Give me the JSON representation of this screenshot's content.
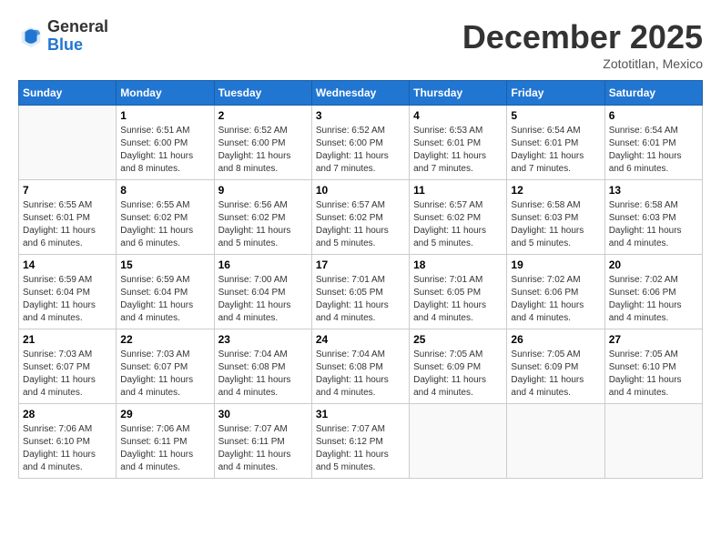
{
  "header": {
    "logo_general": "General",
    "logo_blue": "Blue",
    "month_title": "December 2025",
    "location": "Zototitlan, Mexico"
  },
  "days_of_week": [
    "Sunday",
    "Monday",
    "Tuesday",
    "Wednesday",
    "Thursday",
    "Friday",
    "Saturday"
  ],
  "weeks": [
    [
      {
        "day": "",
        "sunrise": "",
        "sunset": "",
        "daylight": ""
      },
      {
        "day": "1",
        "sunrise": "Sunrise: 6:51 AM",
        "sunset": "Sunset: 6:00 PM",
        "daylight": "Daylight: 11 hours and 8 minutes."
      },
      {
        "day": "2",
        "sunrise": "Sunrise: 6:52 AM",
        "sunset": "Sunset: 6:00 PM",
        "daylight": "Daylight: 11 hours and 8 minutes."
      },
      {
        "day": "3",
        "sunrise": "Sunrise: 6:52 AM",
        "sunset": "Sunset: 6:00 PM",
        "daylight": "Daylight: 11 hours and 7 minutes."
      },
      {
        "day": "4",
        "sunrise": "Sunrise: 6:53 AM",
        "sunset": "Sunset: 6:01 PM",
        "daylight": "Daylight: 11 hours and 7 minutes."
      },
      {
        "day": "5",
        "sunrise": "Sunrise: 6:54 AM",
        "sunset": "Sunset: 6:01 PM",
        "daylight": "Daylight: 11 hours and 7 minutes."
      },
      {
        "day": "6",
        "sunrise": "Sunrise: 6:54 AM",
        "sunset": "Sunset: 6:01 PM",
        "daylight": "Daylight: 11 hours and 6 minutes."
      }
    ],
    [
      {
        "day": "7",
        "sunrise": "Sunrise: 6:55 AM",
        "sunset": "Sunset: 6:01 PM",
        "daylight": "Daylight: 11 hours and 6 minutes."
      },
      {
        "day": "8",
        "sunrise": "Sunrise: 6:55 AM",
        "sunset": "Sunset: 6:02 PM",
        "daylight": "Daylight: 11 hours and 6 minutes."
      },
      {
        "day": "9",
        "sunrise": "Sunrise: 6:56 AM",
        "sunset": "Sunset: 6:02 PM",
        "daylight": "Daylight: 11 hours and 5 minutes."
      },
      {
        "day": "10",
        "sunrise": "Sunrise: 6:57 AM",
        "sunset": "Sunset: 6:02 PM",
        "daylight": "Daylight: 11 hours and 5 minutes."
      },
      {
        "day": "11",
        "sunrise": "Sunrise: 6:57 AM",
        "sunset": "Sunset: 6:02 PM",
        "daylight": "Daylight: 11 hours and 5 minutes."
      },
      {
        "day": "12",
        "sunrise": "Sunrise: 6:58 AM",
        "sunset": "Sunset: 6:03 PM",
        "daylight": "Daylight: 11 hours and 5 minutes."
      },
      {
        "day": "13",
        "sunrise": "Sunrise: 6:58 AM",
        "sunset": "Sunset: 6:03 PM",
        "daylight": "Daylight: 11 hours and 4 minutes."
      }
    ],
    [
      {
        "day": "14",
        "sunrise": "Sunrise: 6:59 AM",
        "sunset": "Sunset: 6:04 PM",
        "daylight": "Daylight: 11 hours and 4 minutes."
      },
      {
        "day": "15",
        "sunrise": "Sunrise: 6:59 AM",
        "sunset": "Sunset: 6:04 PM",
        "daylight": "Daylight: 11 hours and 4 minutes."
      },
      {
        "day": "16",
        "sunrise": "Sunrise: 7:00 AM",
        "sunset": "Sunset: 6:04 PM",
        "daylight": "Daylight: 11 hours and 4 minutes."
      },
      {
        "day": "17",
        "sunrise": "Sunrise: 7:01 AM",
        "sunset": "Sunset: 6:05 PM",
        "daylight": "Daylight: 11 hours and 4 minutes."
      },
      {
        "day": "18",
        "sunrise": "Sunrise: 7:01 AM",
        "sunset": "Sunset: 6:05 PM",
        "daylight": "Daylight: 11 hours and 4 minutes."
      },
      {
        "day": "19",
        "sunrise": "Sunrise: 7:02 AM",
        "sunset": "Sunset: 6:06 PM",
        "daylight": "Daylight: 11 hours and 4 minutes."
      },
      {
        "day": "20",
        "sunrise": "Sunrise: 7:02 AM",
        "sunset": "Sunset: 6:06 PM",
        "daylight": "Daylight: 11 hours and 4 minutes."
      }
    ],
    [
      {
        "day": "21",
        "sunrise": "Sunrise: 7:03 AM",
        "sunset": "Sunset: 6:07 PM",
        "daylight": "Daylight: 11 hours and 4 minutes."
      },
      {
        "day": "22",
        "sunrise": "Sunrise: 7:03 AM",
        "sunset": "Sunset: 6:07 PM",
        "daylight": "Daylight: 11 hours and 4 minutes."
      },
      {
        "day": "23",
        "sunrise": "Sunrise: 7:04 AM",
        "sunset": "Sunset: 6:08 PM",
        "daylight": "Daylight: 11 hours and 4 minutes."
      },
      {
        "day": "24",
        "sunrise": "Sunrise: 7:04 AM",
        "sunset": "Sunset: 6:08 PM",
        "daylight": "Daylight: 11 hours and 4 minutes."
      },
      {
        "day": "25",
        "sunrise": "Sunrise: 7:05 AM",
        "sunset": "Sunset: 6:09 PM",
        "daylight": "Daylight: 11 hours and 4 minutes."
      },
      {
        "day": "26",
        "sunrise": "Sunrise: 7:05 AM",
        "sunset": "Sunset: 6:09 PM",
        "daylight": "Daylight: 11 hours and 4 minutes."
      },
      {
        "day": "27",
        "sunrise": "Sunrise: 7:05 AM",
        "sunset": "Sunset: 6:10 PM",
        "daylight": "Daylight: 11 hours and 4 minutes."
      }
    ],
    [
      {
        "day": "28",
        "sunrise": "Sunrise: 7:06 AM",
        "sunset": "Sunset: 6:10 PM",
        "daylight": "Daylight: 11 hours and 4 minutes."
      },
      {
        "day": "29",
        "sunrise": "Sunrise: 7:06 AM",
        "sunset": "Sunset: 6:11 PM",
        "daylight": "Daylight: 11 hours and 4 minutes."
      },
      {
        "day": "30",
        "sunrise": "Sunrise: 7:07 AM",
        "sunset": "Sunset: 6:11 PM",
        "daylight": "Daylight: 11 hours and 4 minutes."
      },
      {
        "day": "31",
        "sunrise": "Sunrise: 7:07 AM",
        "sunset": "Sunset: 6:12 PM",
        "daylight": "Daylight: 11 hours and 5 minutes."
      },
      {
        "day": "",
        "sunrise": "",
        "sunset": "",
        "daylight": ""
      },
      {
        "day": "",
        "sunrise": "",
        "sunset": "",
        "daylight": ""
      },
      {
        "day": "",
        "sunrise": "",
        "sunset": "",
        "daylight": ""
      }
    ]
  ]
}
